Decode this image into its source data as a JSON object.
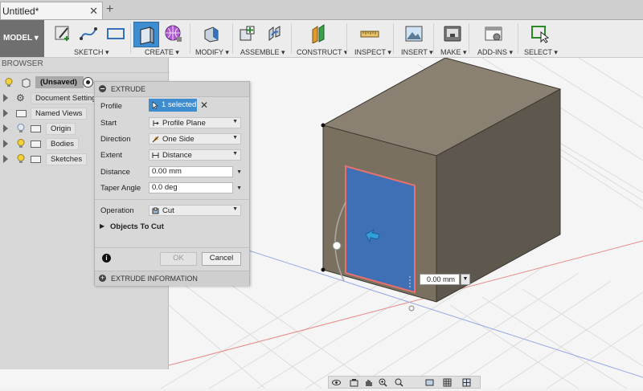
{
  "tab": {
    "title": "Untitled*",
    "close": "✕",
    "new": "+"
  },
  "toolbar": {
    "workspace": "MODEL ▾",
    "groups": [
      {
        "key": "sketch",
        "label": "SKETCH ▾"
      },
      {
        "key": "create",
        "label": "CREATE ▾"
      },
      {
        "key": "modify",
        "label": "MODIFY ▾"
      },
      {
        "key": "assemble",
        "label": "ASSEMBLE ▾"
      },
      {
        "key": "construct",
        "label": "CONSTRUCT ▾"
      },
      {
        "key": "inspect",
        "label": "INSPECT ▾"
      },
      {
        "key": "insert",
        "label": "INSERT ▾"
      },
      {
        "key": "make",
        "label": "MAKE ▾"
      },
      {
        "key": "addins",
        "label": "ADD-INS ▾"
      },
      {
        "key": "select",
        "label": "SELECT ▾"
      }
    ]
  },
  "browser": {
    "title": "BROWSER",
    "root": "(Unsaved)",
    "items": [
      "Document Settings",
      "Named Views",
      "Origin",
      "Bodies",
      "Sketches"
    ]
  },
  "extrude": {
    "title": "EXTRUDE",
    "profile_label": "Profile",
    "profile_value": "1 selected",
    "start_label": "Start",
    "start_value": "Profile Plane",
    "direction_label": "Direction",
    "direction_value": "One Side",
    "extent_label": "Extent",
    "extent_value": "Distance",
    "distance_label": "Distance",
    "distance_value": "0.00 mm",
    "taper_label": "Taper Angle",
    "taper_value": "0.0 deg",
    "operation_label": "Operation",
    "operation_value": "Cut",
    "objects_to_cut": "Objects To Cut",
    "ok": "OK",
    "cancel": "Cancel",
    "info": "EXTRUDE INFORMATION"
  },
  "viewport": {
    "distance_callout": "0.00 mm"
  },
  "colors": {
    "selection_blue": "#3f6fb5",
    "accent": "#3f8dd1",
    "profile_edge": "#e8706d"
  }
}
